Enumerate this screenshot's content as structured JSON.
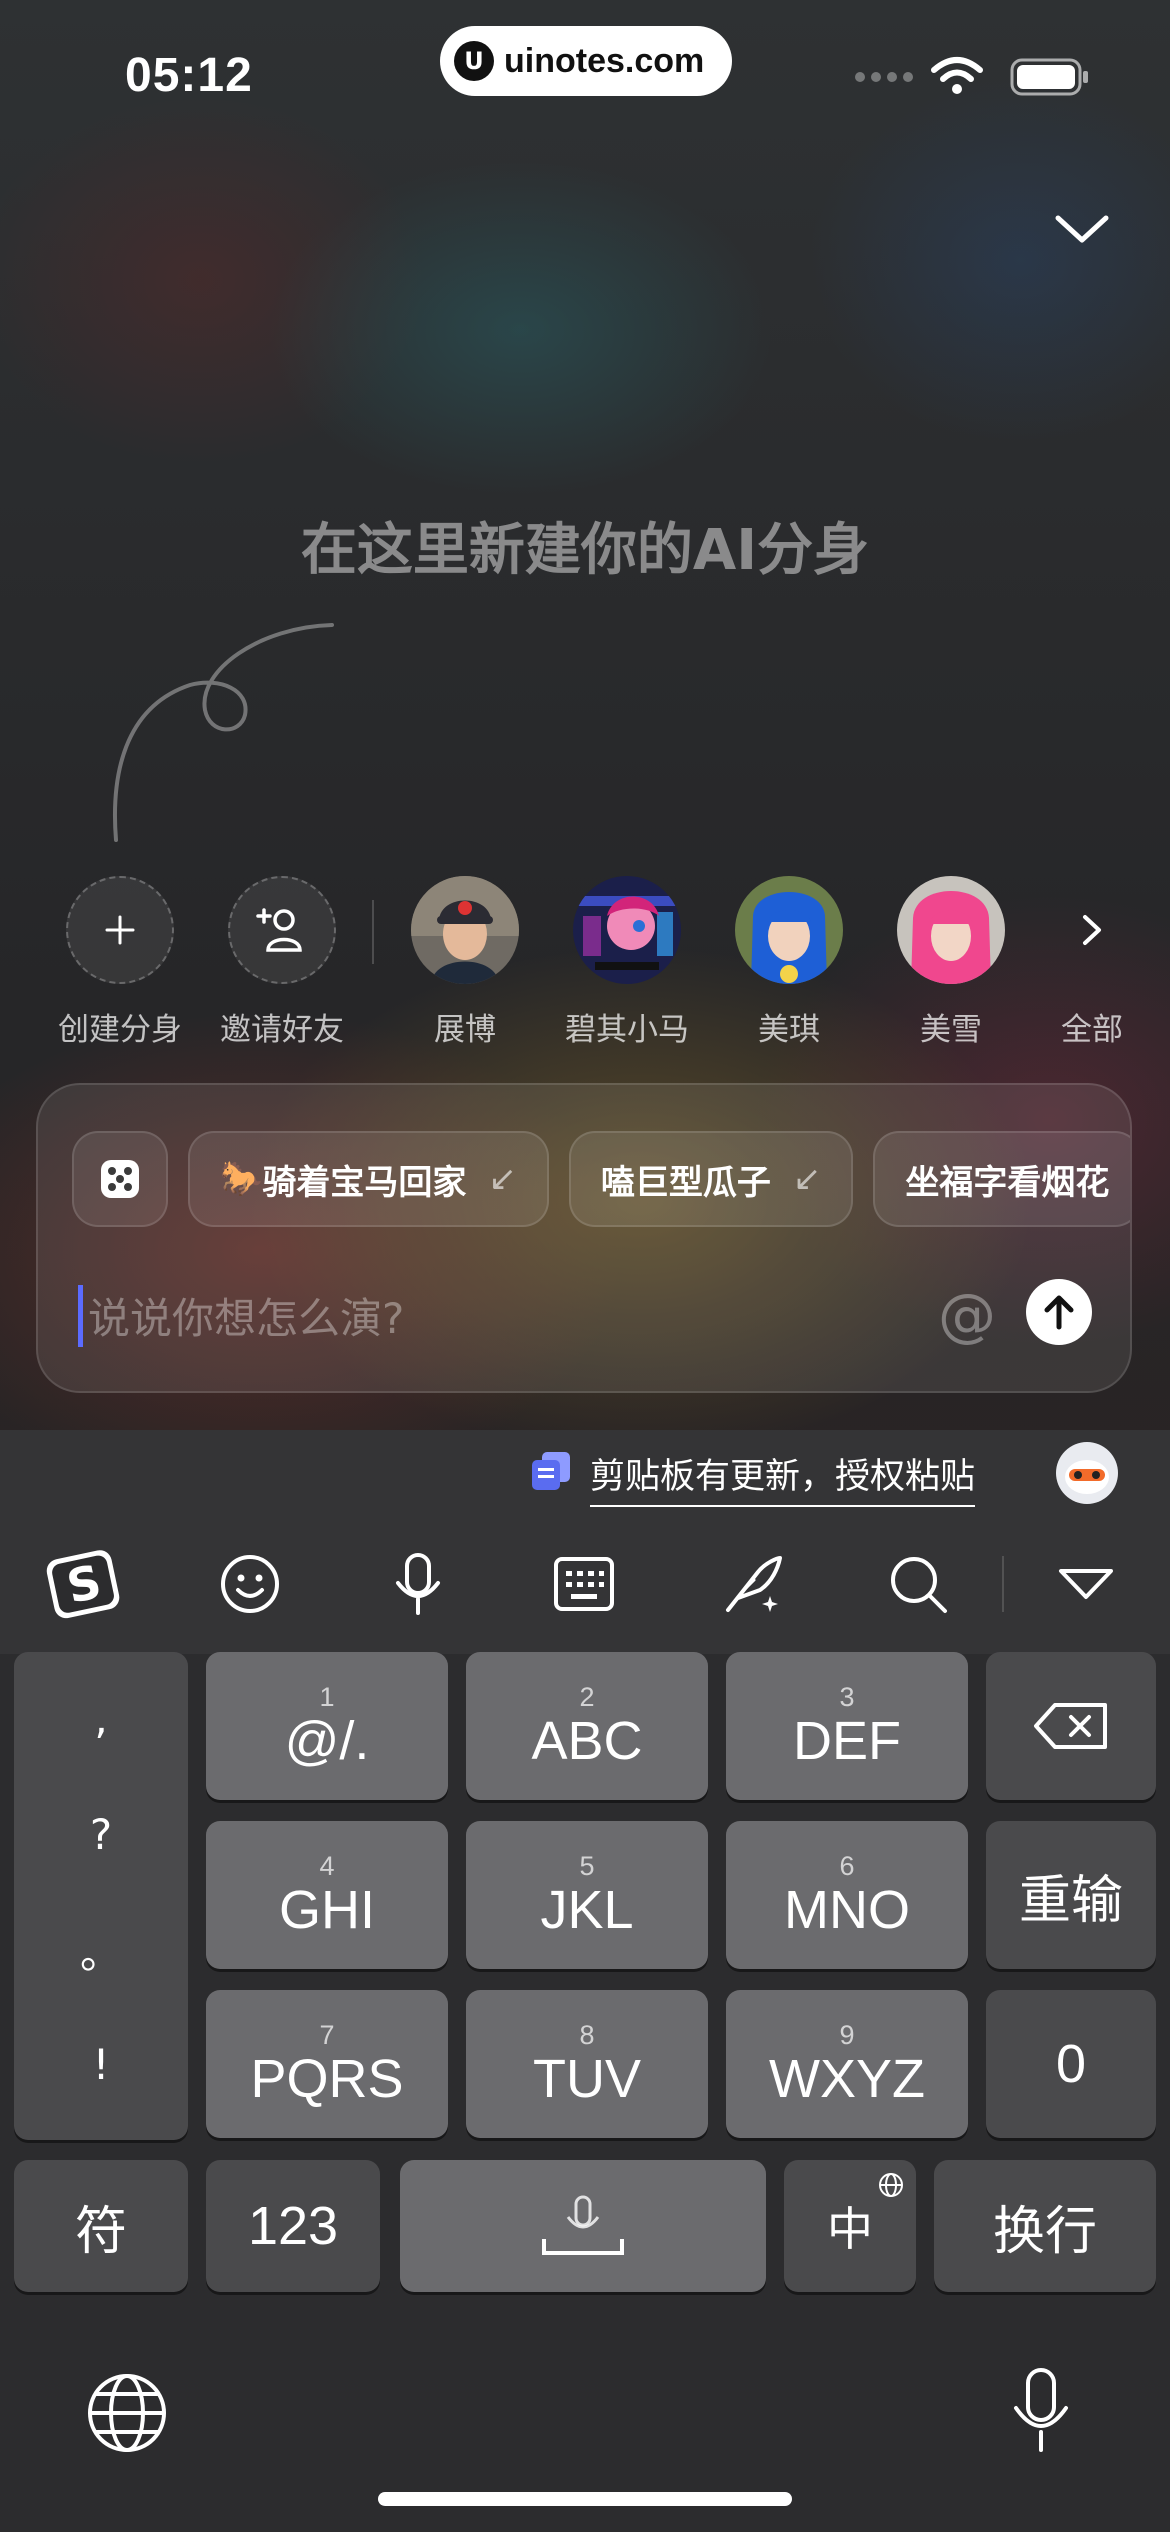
{
  "status_bar": {
    "time": "05:12",
    "site_badge": "uinotes.com"
  },
  "hero": {
    "title": "在这里新建你的AI分身"
  },
  "avatars": [
    {
      "label": "创建分身",
      "kind": "action"
    },
    {
      "label": "邀请好友",
      "kind": "action"
    },
    {
      "label": "展博",
      "kind": "person"
    },
    {
      "label": "碧其小马",
      "kind": "person"
    },
    {
      "label": "美琪",
      "kind": "person"
    },
    {
      "label": "美雪",
      "kind": "person"
    },
    {
      "label": "全部",
      "kind": "more"
    }
  ],
  "chips": [
    {
      "emoji": "🐎",
      "label": "骑着宝马回家",
      "arrow": "↙"
    },
    {
      "label": "嗑巨型瓜子",
      "arrow": "↙"
    },
    {
      "label": "坐福字看烟花"
    }
  ],
  "input": {
    "placeholder": "说说你想怎么演?",
    "at_symbol": "@"
  },
  "keyboard": {
    "clipboard_notice": "剪贴板有更新，授权粘贴",
    "punctuation": [
      ",",
      "?",
      "。",
      "!"
    ],
    "keys": [
      {
        "num": "1",
        "main": "@/."
      },
      {
        "num": "2",
        "main": "ABC"
      },
      {
        "num": "3",
        "main": "DEF"
      },
      {
        "num": "4",
        "main": "GHI"
      },
      {
        "num": "5",
        "main": "JKL"
      },
      {
        "num": "6",
        "main": "MNO"
      },
      {
        "num": "7",
        "main": "PQRS"
      },
      {
        "num": "8",
        "main": "TUV"
      },
      {
        "num": "9",
        "main": "WXYZ"
      }
    ],
    "reinput": "重输",
    "zero": "0",
    "symbols": "符",
    "numbers": "123",
    "chinese": "中",
    "newline": "换行"
  }
}
